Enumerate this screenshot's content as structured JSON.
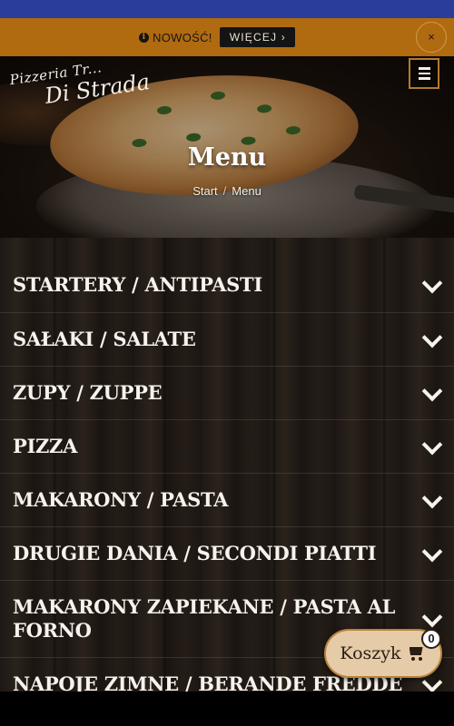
{
  "notice": {
    "label": "NOWOŚĆ!",
    "more_label": "WIĘCEJ ›",
    "close_label": "×"
  },
  "header": {
    "logo_line1": "Pizzeria Tr...",
    "logo_line2": "Di Strada"
  },
  "hero": {
    "title": "Menu",
    "breadcrumb": [
      "Start",
      "/",
      "Menu"
    ]
  },
  "categories": [
    {
      "label": "STARTERY / ANTIPASTI"
    },
    {
      "label": "SAŁAKI / SALATE"
    },
    {
      "label": "ZUPY / ZUPPE"
    },
    {
      "label": "PIZZA"
    },
    {
      "label": "MAKARONY / PASTA"
    },
    {
      "label": "DRUGIE DANIA / SECONDI PIATTI"
    },
    {
      "label": "MAKARONY ZAPIEKANE / PASTA AL FORNO"
    },
    {
      "label": "NAPOJE ZIMNE / BERANDE FREDDE"
    }
  ],
  "cart": {
    "label": "Koszyk",
    "count": "0"
  },
  "colors": {
    "top_bar": "#2b3d9a",
    "notice_bar": "#b06a10",
    "accent": "#b57a2e",
    "cart_bg": "#e5cba7"
  },
  "icons": [
    "info-icon",
    "close-icon",
    "hamburger-icon",
    "chevron-down-icon",
    "cart-icon"
  ]
}
